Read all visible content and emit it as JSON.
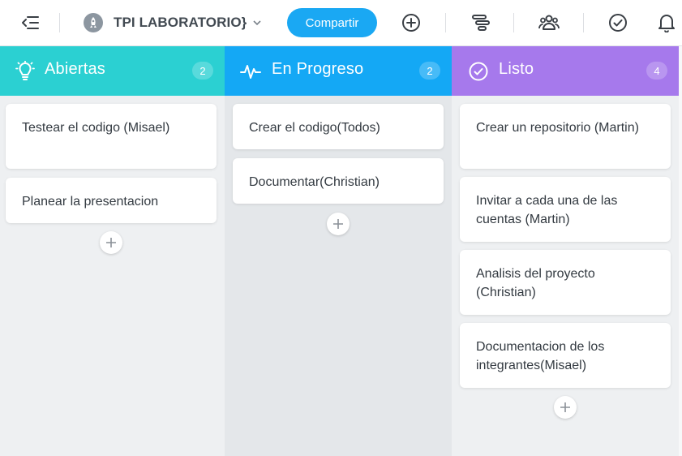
{
  "topbar": {
    "project_title": "TPI LABORATORIO}",
    "share_label": "Compartir",
    "icons": [
      "collapse-menu-icon",
      "rocket-icon",
      "chevron-down-icon",
      "add-circle-icon",
      "timeline-icon",
      "team-icon",
      "check-circle-icon",
      "bell-icon"
    ]
  },
  "columns": [
    {
      "title": "Abiertas",
      "count": "2",
      "icon": "lightbulb-icon",
      "header_color": "#2bd0d2",
      "cards": [
        "Testear el codigo (Misael)",
        "Planear la presentacion"
      ]
    },
    {
      "title": "En Progreso",
      "count": "2",
      "icon": "pulse-icon",
      "header_color": "#14a8f5",
      "cards": [
        "Crear el codigo(Todos)",
        "Documentar(Christian)"
      ]
    },
    {
      "title": "Listo",
      "count": "4",
      "icon": "check-circle-icon",
      "header_color": "#a679ec",
      "cards": [
        "Crear un repositorio (Martin)",
        "Invitar a cada una de las cuentas (Martin)",
        "Analisis del proyecto (Christian)",
        "Documentacion de los integrantes(Misael)"
      ]
    }
  ],
  "colors": {
    "accent": "#1aa8f3",
    "board_bg": "#eef0f2"
  }
}
